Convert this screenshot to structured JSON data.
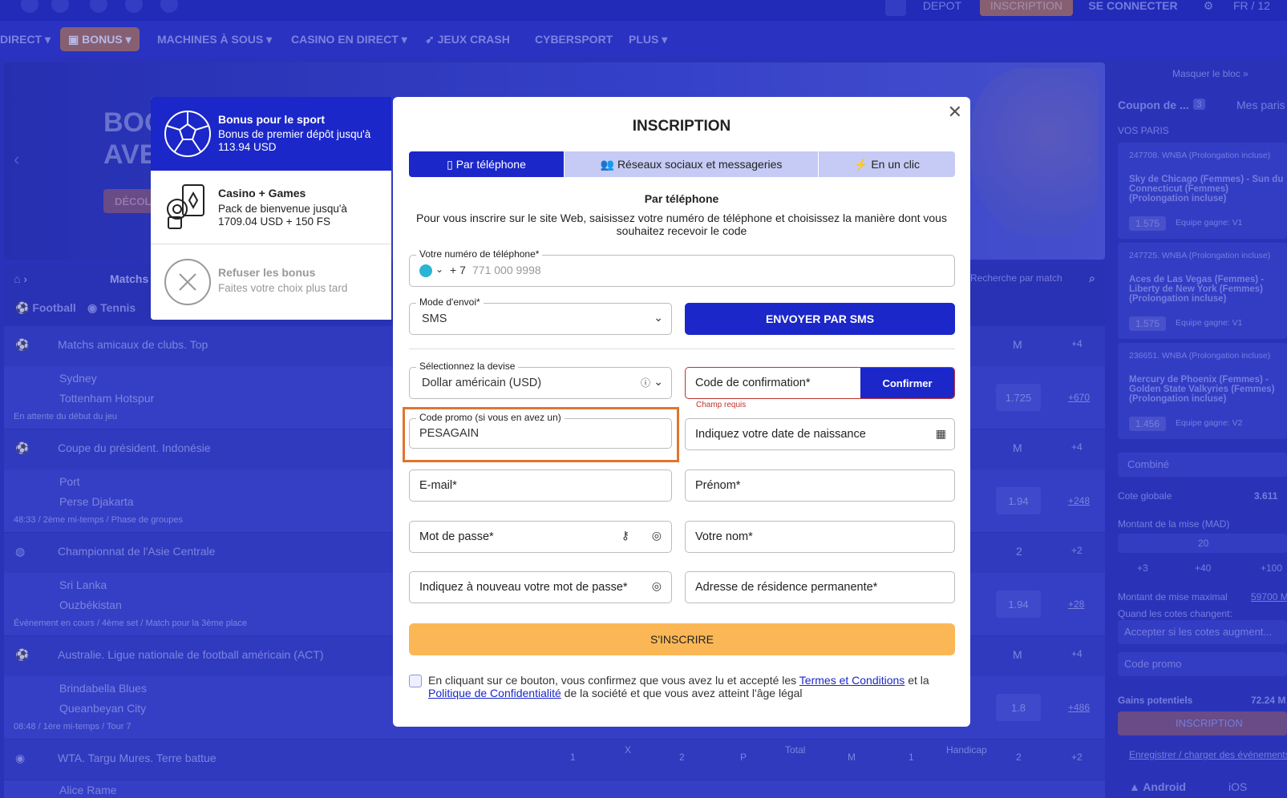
{
  "topbar": {
    "depot": "DEPOT",
    "inscription": "INSCRIPTION",
    "connect": "SE CONNECTER",
    "lang": "FR / 12"
  },
  "nav": {
    "items": [
      "DIRECT",
      "BONUS",
      "MACHINES À SOUS",
      "CASINO EN DIRECT",
      "JEUX CRASH",
      "CYBERSPORT",
      "PLUS"
    ]
  },
  "banner": {
    "title1": "BOO",
    "title2": "AVE",
    "button": "DÉCOL"
  },
  "crumb": {
    "matchs": "Matchs",
    "football": "Football",
    "tennis": "Tennis",
    "search": "Recherche par match"
  },
  "events": [
    {
      "league": "Matchs amicaux de clubs. Top",
      "m": "M",
      "more": "+4",
      "team1": "Sydney",
      "team2": "Tottenham Hotspur",
      "status": "En attente du début du jeu",
      "odd": "1.725",
      "extra": "+670"
    },
    {
      "league": "Coupe du président. Indonésie",
      "m": "M",
      "more": "+4",
      "team1": "Port",
      "team2": "Perse Djakarta",
      "status": "48:33 / 2ème mi-temps / Phase de groupes",
      "odd": "1.94",
      "extra": "+248"
    },
    {
      "league": "Championnat de l'Asie Centrale",
      "m": "2",
      "more": "+2",
      "team1": "Sri Lanka",
      "team2": "Ouzbékistan",
      "status": "Événement en cours / 4ème set / Match pour la 3ème place",
      "odd": "1.94",
      "extra": "+28"
    },
    {
      "league": "Australie. Ligue nationale de football américain (ACT)",
      "m": "M",
      "more": "+4",
      "team1": "Brindabella Blues",
      "team2": "Queanbeyan City",
      "status": "08:48 / 1ère mi-temps / Tour 7",
      "odd": "1.8",
      "extra": "+486"
    },
    {
      "league": "WTA. Targu Mures. Terre battue",
      "m": "2",
      "more": "+2",
      "team1": "Alice Rame",
      "team2": "",
      "status": "",
      "odd": "",
      "extra": ""
    }
  ],
  "wta_cols": {
    "c1": "1",
    "cx": "X",
    "c2": "2",
    "p": "P",
    "total": "Total",
    "m": "M",
    "h1": "1",
    "handicap": "Handicap",
    "h2": "2",
    "more": "+2"
  },
  "sidebar": {
    "hide": "Masquer le bloc »",
    "coupon": "Coupon de ...",
    "count": "3",
    "mes": "Mes paris",
    "vos": "VOS PARIS",
    "bets": [
      {
        "league": "247708. WNBA (Prolongation incluse)",
        "match": "Sky de Chicago (Femmes) - Sun du Connecticut (Femmes) (Prolongation incluse)",
        "odd": "1.575",
        "pick": "Equipe gagne: V1"
      },
      {
        "league": "247725. WNBA (Prolongation incluse)",
        "match": "Aces de Las Vegas (Femmes) - Liberty de New York (Femmes) (Prolongation incluse)",
        "odd": "1.575",
        "pick": "Equipe gagne: V1"
      },
      {
        "league": "236651. WNBA (Prolongation incluse)",
        "match": "Mercury de Phoenix (Femmes) - Golden State Valkyries (Femmes) (Prolongation incluse)",
        "odd": "1.456",
        "pick": "Equipe gagne: V2"
      }
    ],
    "combine": "Combiné",
    "cote_label": "Cote globale",
    "cote": "3.611",
    "mise_label": "Montant de la mise (MAD)",
    "mise": "20",
    "q1": "+3",
    "q2": "+40",
    "q3": "+100",
    "max_label": "Montant de mise maximal",
    "max": "59700 M",
    "change_label": "Quand les cotes changent:",
    "accept": "Accepter si les cotes augment...",
    "promo": "Code promo",
    "gains_label": "Gains potentiels",
    "gains": "72.24 M",
    "inscription": "INSCRIPTION",
    "register": "Enregistrer / charger des événements",
    "android": "Android",
    "ios": "iOS"
  },
  "bonuses": [
    {
      "title": "Bonus pour le sport",
      "desc1": "Bonus de premier dépôt jusqu'à",
      "desc2": "113.94 USD"
    },
    {
      "title": "Casino + Games",
      "desc1": "Pack de bienvenue jusqu'à",
      "desc2": "1709.04 USD + 150 FS"
    },
    {
      "title": "Refuser les bonus",
      "desc1": "Faites votre choix plus tard",
      "desc2": ""
    }
  ],
  "modal": {
    "title": "INSCRIPTION",
    "tabs": [
      "Par téléphone",
      "Réseaux sociaux et messageries",
      "En un clic"
    ],
    "subtitle": "Par téléphone",
    "intro1": "Pour vous inscrire sur le site Web, saisissez votre numéro de téléphone et choisissez la manière dont vous",
    "intro2": "souhaitez recevoir le code",
    "phone_label": "Votre numéro de téléphone*",
    "phone_prefix": "+ 7",
    "phone_placeholder": "771 000 9998",
    "mode_label": "Mode d'envoi*",
    "mode_value": "SMS",
    "send_sms": "ENVOYER PAR SMS",
    "currency_label": "Sélectionnez la devise",
    "currency_value": "Dollar américain (USD)",
    "code_placeholder": "Code de confirmation*",
    "confirm": "Confirmer",
    "required": "Champ requis",
    "promo_label": "Code promo (si vous en avez un)",
    "promo_value": "PESAGAIN",
    "birth": "Indiquez votre date de naissance",
    "email": "E-mail*",
    "firstname": "Prénom*",
    "password": "Mot de passe*",
    "lastname": "Votre nom*",
    "password2": "Indiquez à nouveau votre mot de passe*",
    "address": "Adresse de résidence permanente*",
    "submit": "S'INSCRIRE",
    "terms1": "En cliquant sur ce bouton, vous confirmez que vous avez lu et accepté les ",
    "terms_link": "Termes et Conditions",
    "terms2": " et la ",
    "privacy_link": "Politique de Confidentialité",
    "terms3": " de la société et que vous avez atteint l'âge légal"
  },
  "colors": {
    "primary": "#1b27c9",
    "submit": "#fbb755",
    "highlight": "#e0752f",
    "error": "#c0322c"
  }
}
